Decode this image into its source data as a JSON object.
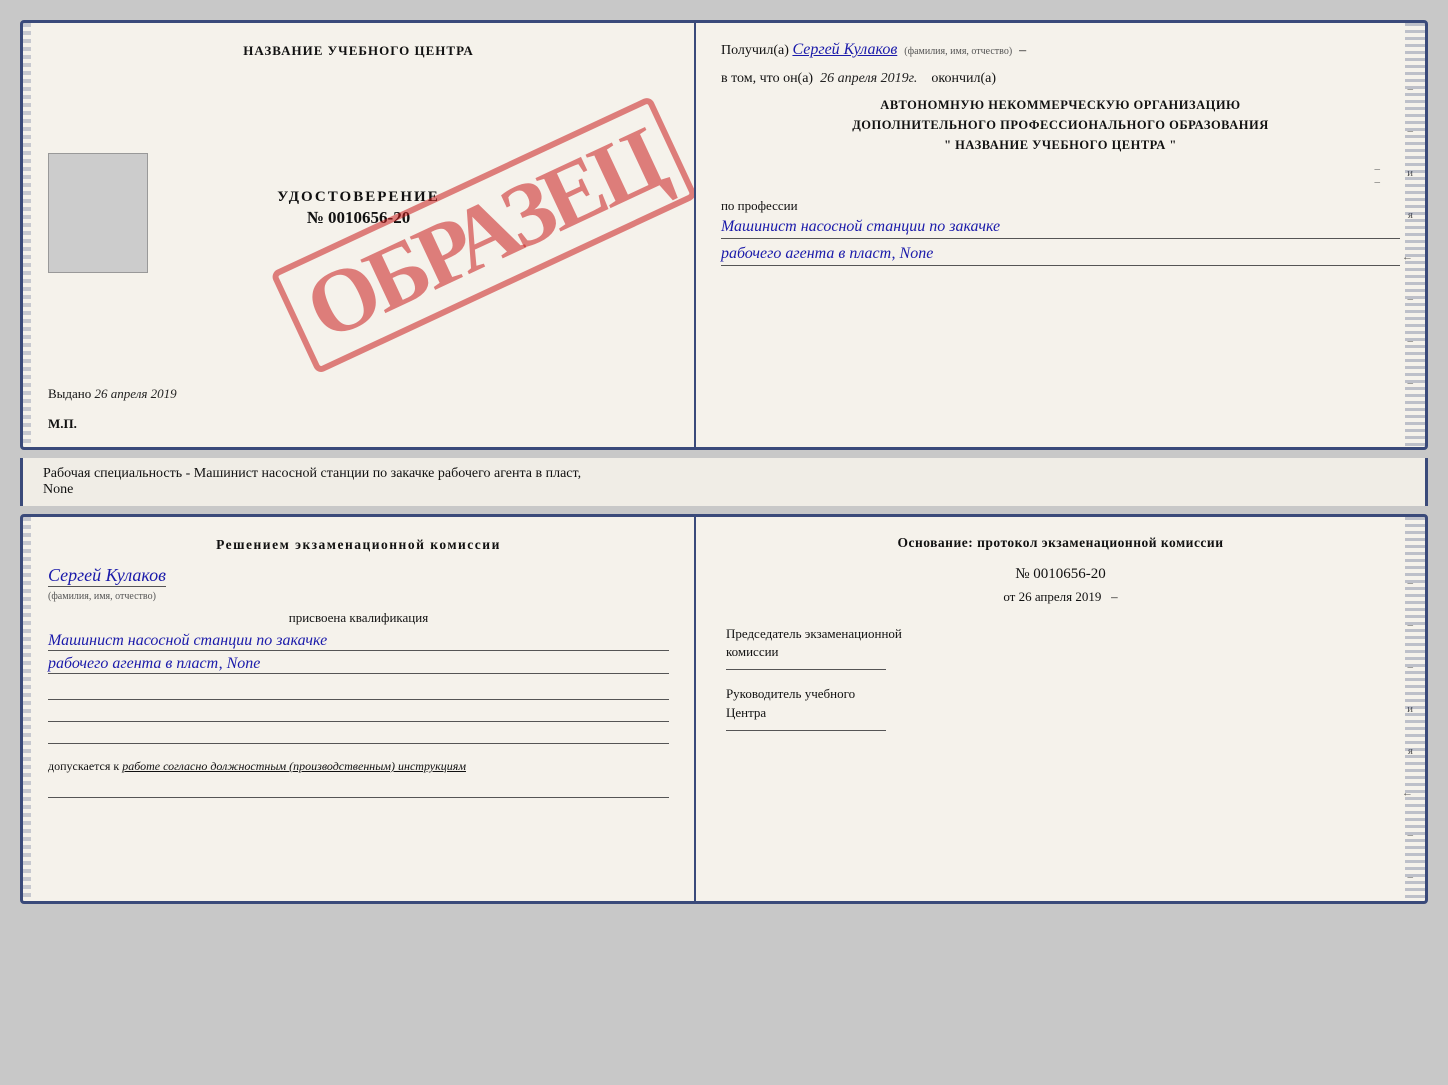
{
  "top_doc": {
    "left": {
      "center_name": "НАЗВАНИЕ УЧЕБНОГО ЦЕНТРА",
      "udostoverenie": "УДОСТОВЕРЕНИЕ",
      "number": "№ 0010656-20",
      "vydano_label": "Выдано",
      "vydano_date": "26 апреля 2019",
      "mp": "М.П.",
      "stamp": "ОБРАЗЕЦ"
    },
    "right": {
      "poluchil_label": "Получил(а)",
      "poluchil_name": "Сергей Кулаков",
      "familiya_hint": "(фамилия, имя, отчество)",
      "v_tom_label": "в том, что он(а)",
      "v_tom_date": "26 апреля 2019г.",
      "okonchil": "окончил(а)",
      "org_line1": "АВТОНОМНУЮ НЕКОММЕРЧЕСКУЮ ОРГАНИЗАЦИЮ",
      "org_line2": "ДОПОЛНИТЕЛЬНОГО ПРОФЕССИОНАЛЬНОГО ОБРАЗОВАНИЯ",
      "org_quote": "\"  НАЗВАНИЕ УЧЕБНОГО ЦЕНТРА  \"",
      "po_professii": "по профессии",
      "profession_line1": "Машинист насосной станции по закачке",
      "profession_line2": "рабочего агента в пласт, None"
    }
  },
  "middle": {
    "text": "Рабочая специальность - Машинист насосной станции по закачке рабочего агента в пласт,",
    "text2": "None"
  },
  "bottom_doc": {
    "left": {
      "resheniem": "Решением экзаменационной комиссии",
      "person_name": "Сергей Кулаков",
      "familiya_hint": "(фамилия, имя, отчество)",
      "prisvoena": "присвоена квалификация",
      "kvalif_line1": "Машинист насосной станции по закачке",
      "kvalif_line2": "рабочего агента в пласт, None",
      "dopuskaetsya": "допускается к",
      "dopusk_italic": "работе согласно должностным (производственным) инструкциям"
    },
    "right": {
      "osnovanie": "Основание: протокол экзаменационной комиссии",
      "protocol_no": "№ 0010656-20",
      "ot_label": "от",
      "ot_date": "26 апреля 2019",
      "predsedatel_line1": "Председатель экзаменационной",
      "predsedatel_line2": "комиссии",
      "rukovoditel_line1": "Руководитель учебного",
      "rukovoditel_line2": "Центра"
    }
  },
  "decoration": {
    "dash": "–",
    "and": "и",
    "ya": "я",
    "arrow": "←"
  }
}
